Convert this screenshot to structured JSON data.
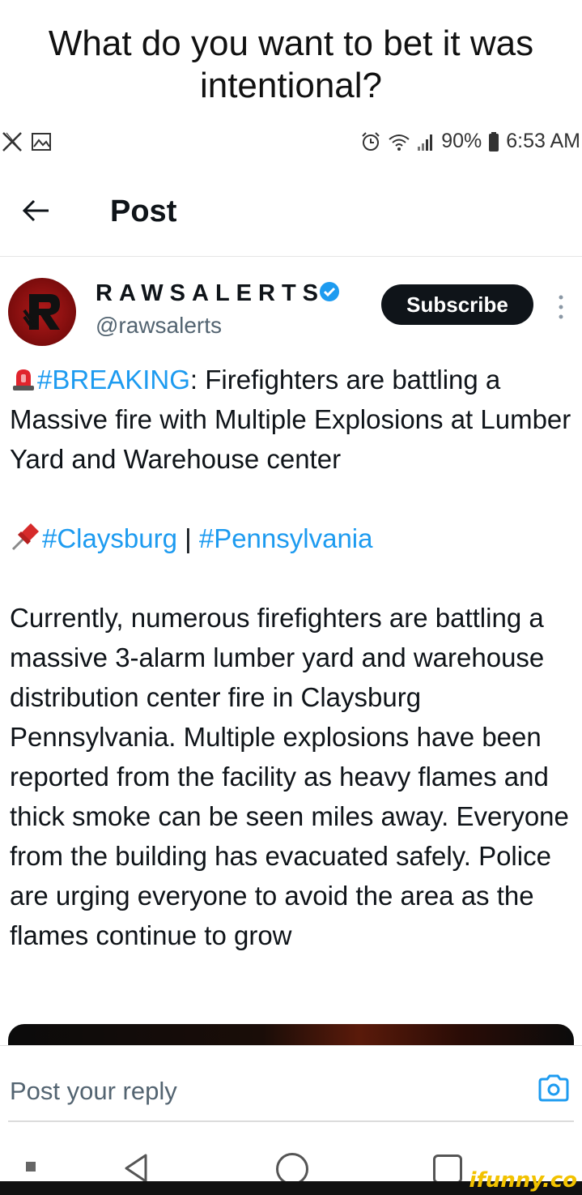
{
  "caption": {
    "line1": "What do you want to bet it was",
    "line2": "intentional?"
  },
  "status_bar": {
    "left_icons": [
      "x-logo-icon",
      "image-icon"
    ],
    "battery": "90%",
    "time": "6:53 AM",
    "right_icons": [
      "alarm-icon",
      "wifi-icon",
      "signal-icon",
      "battery-icon"
    ]
  },
  "header": {
    "title": "Post"
  },
  "post": {
    "author_name": "RAWSALERTS",
    "handle": "@rawsalerts",
    "subscribe_label": "Subscribe",
    "breaking_tag": "#BREAKING",
    "breaking_text": ": Firefighters are battling a Massive fire with Multiple Explosions at Lumber Yard and Warehouse center",
    "location_tag_1": "#Claysburg",
    "separator": " | ",
    "location_tag_2": "#Pennsylvania",
    "body": "Currently, numerous firefighters are battling a massive 3-alarm lumber yard and warehouse distribution center fire in Claysburg Pennsylvania. Multiple explosions have been reported from the facility as heavy flames and thick smoke can be seen miles away. Everyone from the building has evacuated safely. Police are urging everyone to avoid the area as the flames continue to grow"
  },
  "reply": {
    "placeholder": "Post your reply"
  },
  "watermark": "ifunny.co",
  "colors": {
    "hashtag": "#1d9bf0",
    "verified": "#1d9bf0",
    "subscribe_bg": "#0f1419",
    "watermark": "#f2c200"
  }
}
